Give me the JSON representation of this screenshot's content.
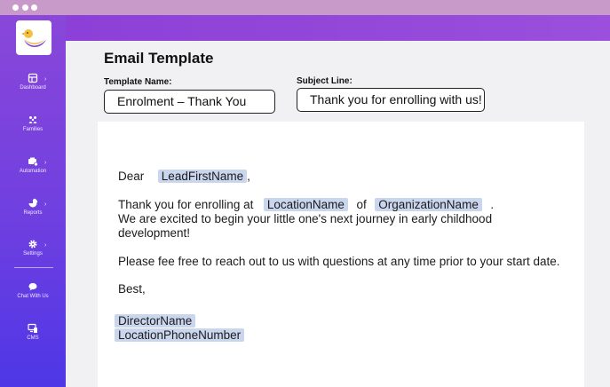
{
  "window": {
    "controls": [
      "dot",
      "dot",
      "dot"
    ]
  },
  "sidebar": {
    "logo": "duck-logo",
    "items": [
      {
        "label": "Dashboard",
        "icon": "dashboard-icon",
        "has_submenu": true
      },
      {
        "label": "Families",
        "icon": "families-icon",
        "has_submenu": false
      },
      {
        "label": "Automation",
        "icon": "automation-icon",
        "has_submenu": true
      },
      {
        "label": "Reports",
        "icon": "reports-icon",
        "has_submenu": true
      },
      {
        "label": "Settings",
        "icon": "settings-icon",
        "has_submenu": true
      },
      {
        "label": "Chat With Us",
        "icon": "chat-icon",
        "has_submenu": false
      },
      {
        "label": "CMS",
        "icon": "cms-icon",
        "has_submenu": false
      }
    ],
    "chevron": "›"
  },
  "page": {
    "title": "Email Template",
    "template_name_label": "Template Name:",
    "template_name_value": "Enrolment – Thank You",
    "subject_label": "Subject Line:",
    "subject_value": "Thank you for enrolling with us!"
  },
  "email": {
    "greeting_prefix": "Dear",
    "greeting_tag": "LeadFirstName",
    "greeting_suffix": ",",
    "p1_prefix": "Thank you for enrolling at",
    "p1_tag1": "LocationName",
    "p1_mid": "of",
    "p1_tag2": "OrganizationName",
    "p1_suffix": ".",
    "p1_line2": "We are excited to begin your little one's next journey in early childhood",
    "p1_line3": "development!",
    "p2": "Please fee free to reach out to us with questions at any time prior to your start date.",
    "signoff": "Best,",
    "sig_tag1": "DirectorName",
    "sig_tag2": "LocationPhoneNumber"
  },
  "colors": {
    "titlebar": "#c79ac9",
    "sidebar_top": "#8a47d9",
    "sidebar_bottom": "#4e37e6",
    "merge_tag_bg": "#c9d6ee"
  }
}
